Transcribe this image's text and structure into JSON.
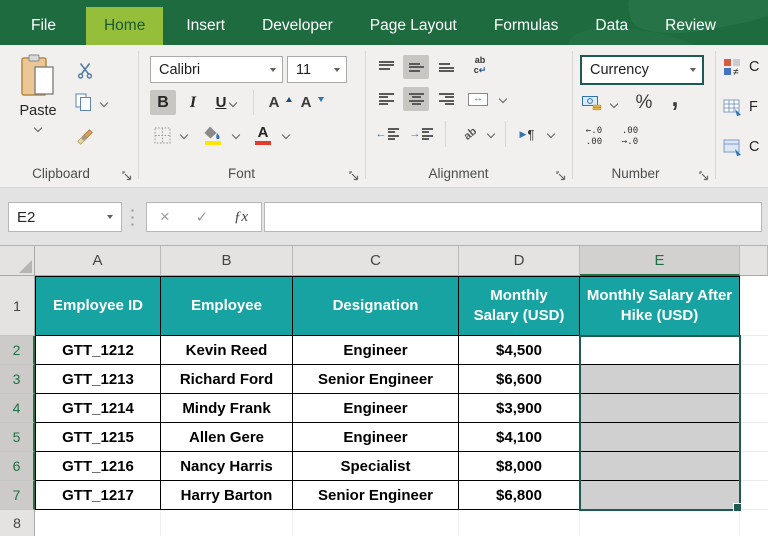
{
  "ribbon": {
    "tabs": [
      {
        "label": "File"
      },
      {
        "label": "Home"
      },
      {
        "label": "Insert"
      },
      {
        "label": "Developer"
      },
      {
        "label": "Page Layout"
      },
      {
        "label": "Formulas"
      },
      {
        "label": "Data"
      },
      {
        "label": "Review"
      }
    ],
    "active_tab": "Home",
    "clipboard": {
      "label": "Clipboard",
      "paste": "Paste"
    },
    "font": {
      "label": "Font",
      "family": "Calibri",
      "size": "11",
      "bold": "B",
      "italic": "I",
      "underline": "U",
      "grow": "A",
      "shrink": "A",
      "color_letter": "A"
    },
    "alignment": {
      "label": "Alignment",
      "wrap_top": "ab",
      "wrap_bottom": "c",
      "wrap_arrow": "↵",
      "merge_arrow": "↔",
      "orientation": "ab",
      "direction_play": "▶",
      "pilcrow": "¶"
    },
    "number": {
      "label": "Number",
      "format": "Currency",
      "percent": "%",
      "comma": ",",
      "inc_top": "←.0",
      "inc_bottom": ".00",
      "dec_top": ".00",
      "dec_bottom": "→.0"
    },
    "styles": {
      "items": [
        "C",
        "F",
        "C"
      ]
    }
  },
  "formula_bar": {
    "name_box": "E2",
    "cancel": "×",
    "enter": "✓",
    "fx": "ƒx",
    "value": ""
  },
  "sheet": {
    "column_headers": [
      "A",
      "B",
      "C",
      "D",
      "E"
    ],
    "row_numbers": [
      "1",
      "2",
      "3",
      "4",
      "5",
      "6",
      "7",
      "8"
    ],
    "selection": {
      "active_cell": "E2",
      "range": "E2:E7"
    },
    "table": {
      "headers": [
        "Employee ID",
        "Employee",
        "Designation",
        "Monthly Salary (USD)",
        "Monthly Salary After Hike (USD)"
      ],
      "rows": [
        [
          "GTT_1212",
          "Kevin Reed",
          "Engineer",
          "$4,500",
          ""
        ],
        [
          "GTT_1213",
          "Richard Ford",
          "Senior Engineer",
          "$6,600",
          ""
        ],
        [
          "GTT_1214",
          "Mindy Frank",
          "Engineer",
          "$3,900",
          ""
        ],
        [
          "GTT_1215",
          "Allen Gere",
          "Engineer",
          "$4,100",
          ""
        ],
        [
          "GTT_1216",
          "Nancy Harris",
          "Specialist",
          "$8,000",
          ""
        ],
        [
          "GTT_1217",
          "Harry Barton",
          "Senior Engineer",
          "$6,800",
          ""
        ]
      ]
    }
  },
  "colors": {
    "ribbon_green": "#1F6B40",
    "active_tab_green": "#95BF3B",
    "header_teal": "#18A3A3",
    "selection_border": "#1D5B52",
    "selection_fill": "#D0D0D0",
    "fill_color_swatch": "#FFE600",
    "font_color_swatch": "#E53A2E"
  }
}
